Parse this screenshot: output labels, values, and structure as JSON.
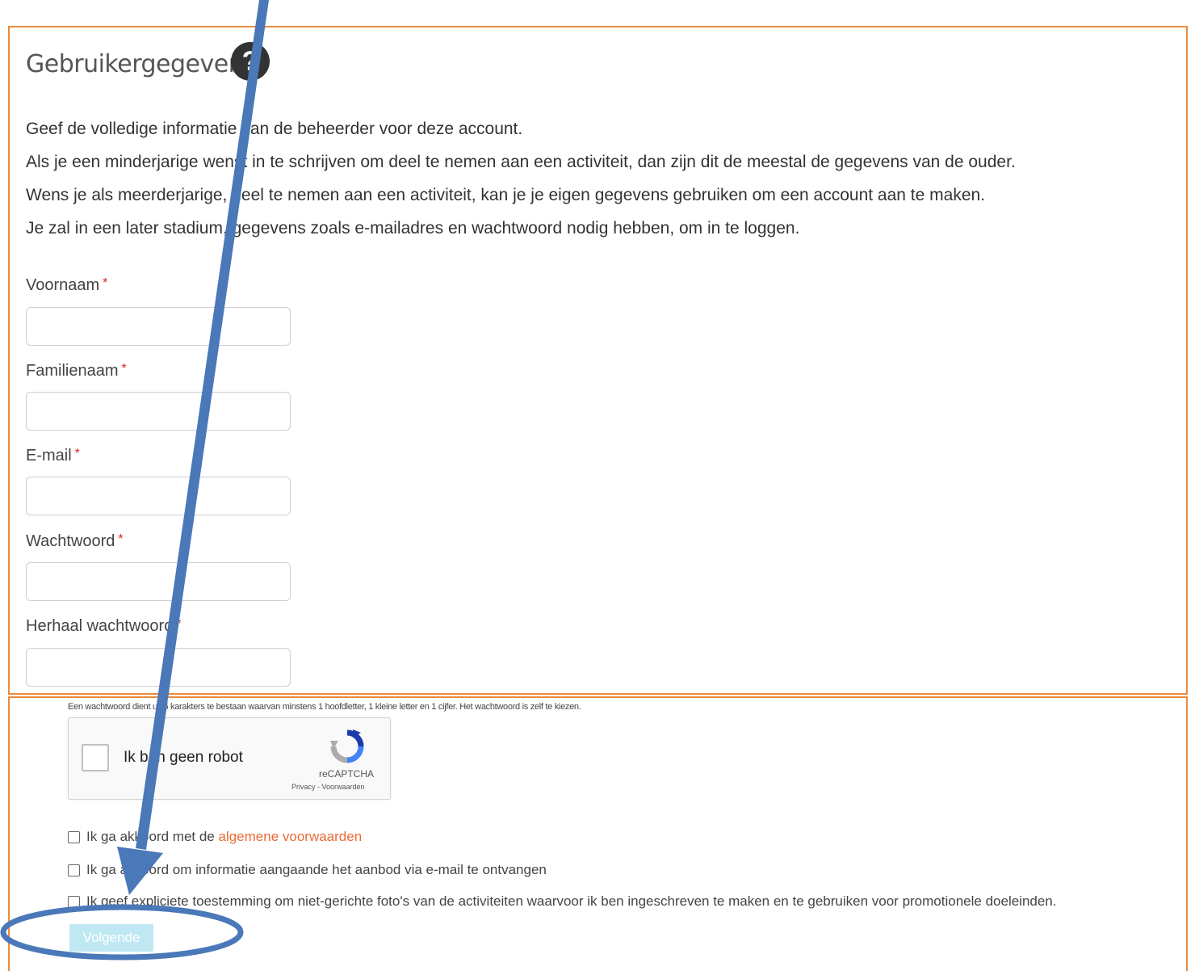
{
  "section": {
    "title": "Gebruikergegevens",
    "help_glyph": "?",
    "intro": [
      "Geef de volledige informatie van de beheerder voor deze account.",
      "Als je een minderjarige wenst in te schrijven om deel te nemen aan een activiteit, dan zijn dit de meestal de gegevens van de ouder.",
      "Wens je als meerderjarige, deel te nemen aan een activiteit, kan je je eigen gegevens gebruiken om een account aan te maken.",
      "Je zal in een later stadium, gegevens zoals e-mailadres en wachtwoord nodig hebben, om in te loggen."
    ]
  },
  "form": {
    "required_mark": "*",
    "fields": [
      {
        "label": "Voornaam",
        "value": ""
      },
      {
        "label": "Familienaam",
        "value": ""
      },
      {
        "label": "E-mail",
        "value": ""
      },
      {
        "label": "Wachtwoord",
        "value": ""
      },
      {
        "label": "Herhaal wachtwoord",
        "value": ""
      }
    ],
    "password_hint": "Een wachtwoord dient uit 6 karakters te bestaan waarvan minstens 1 hoofdletter, 1 kleine letter en 1 cijfer. Het wachtwoord is zelf te kiezen."
  },
  "captcha": {
    "label": "Ik ben geen robot",
    "brand": "reCAPTCHA",
    "links": "Privacy - Voorwaarden",
    "checked": false
  },
  "agreements": {
    "terms_prefix": "Ik ga akkoord met de ",
    "terms_link": "algemene voorwaarden",
    "email_info": "Ik ga akkoord om informatie aangaande het aanbod via e-mail te ontvangen",
    "photo_consent": "Ik geef expliciete toestemming om niet-gerichte foto's van de activiteiten waarvoor ik ben ingeschreven te maken en te gebruiken voor promotionele doeleinden."
  },
  "next_button": "Volgende",
  "colors": {
    "accent": "#ec8a3c",
    "link": "#ec6a34",
    "required": "#e02020",
    "annotation": "#4a78b8",
    "button_disabled": "#bfe8f3"
  }
}
